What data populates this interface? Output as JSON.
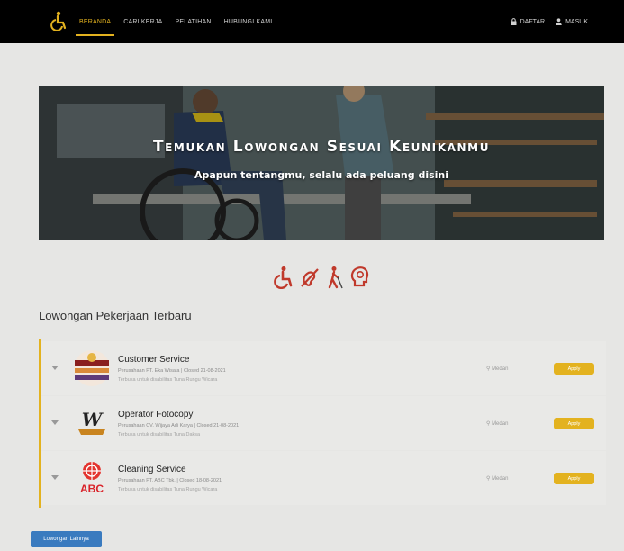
{
  "navbar": {
    "links": [
      {
        "label": "BERANDA",
        "active": true
      },
      {
        "label": "CARI KERJA",
        "active": false
      },
      {
        "label": "PELATIHAN",
        "active": false
      },
      {
        "label": "HUBUNGI KAMI",
        "active": false
      }
    ],
    "right": {
      "register_label": "DAFTAR",
      "login_label": "MASUK"
    },
    "brand_icon": "wheelchair-icon"
  },
  "hero": {
    "title": "Temukan Lowongan Sesuai Keunikanmu",
    "subtitle": "Apapun tentangmu, selalu ada peluang disini"
  },
  "disability_icons": [
    "wheelchair-icon",
    "deaf-icon",
    "blind-walking-icon",
    "head-cognitive-icon"
  ],
  "section_title": "Lowongan Pekerjaan Terbaru",
  "jobs": [
    {
      "title": "Customer Service",
      "company": "Perusahaan PT. Eka Wisata | Closed 21-08-2021",
      "note": "Terbuka untuk disabilitas Tuna Rungu Wicara",
      "location": "Medan",
      "apply_label": "Apply"
    },
    {
      "title": "Operator Fotocopy",
      "company": "Perusahaan CV. Wijaya Adi Karya | Closed 21-08-2021",
      "note": "Terbuka untuk disabilitas Tuna Daksa",
      "location": "Medan",
      "apply_label": "Apply"
    },
    {
      "title": "Cleaning Service",
      "company": "Perusahaan PT. ABC Tbk. | Closed 18-08-2021",
      "note": "Terbuka untuk disabilitas Tuna Rungu Wicara",
      "location": "Medan",
      "apply_label": "Apply"
    }
  ],
  "logo_texts": {
    "wak": "W",
    "abc": "ABC"
  },
  "more_button_label": "Lowongan Lainnya",
  "colors": {
    "accent": "#e3b21f",
    "primary": "#3a7bbf",
    "navbar": "#000000",
    "icon_red": "#c0392b"
  }
}
